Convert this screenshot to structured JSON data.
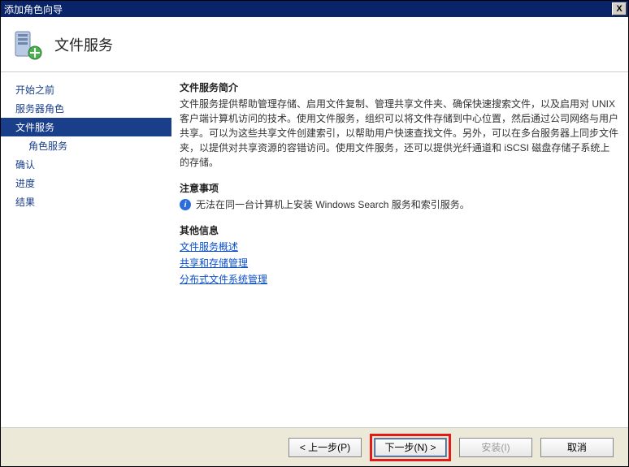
{
  "titlebar": {
    "title": "添加角色向导",
    "close": "X"
  },
  "header": {
    "title": "文件服务"
  },
  "sidebar": {
    "items": [
      {
        "label": "开始之前"
      },
      {
        "label": "服务器角色"
      },
      {
        "label": "文件服务"
      },
      {
        "label": "角色服务"
      },
      {
        "label": "确认"
      },
      {
        "label": "进度"
      },
      {
        "label": "结果"
      }
    ]
  },
  "content": {
    "intro_h": "文件服务简介",
    "intro_p": "文件服务提供帮助管理存储、启用文件复制、管理共享文件夹、确保快速搜索文件，以及启用对 UNIX 客户端计算机访问的技术。使用文件服务，组织可以将文件存储到中心位置，然后通过公司网络与用户共享。可以为这些共享文件创建索引，以帮助用户快速查找文件。另外，可以在多台服务器上同步文件夹，以提供对共享资源的容错访问。使用文件服务，还可以提供光纤通道和 iSCSI 磁盘存储子系统上的存储。",
    "notes_h": "注意事项",
    "notes_item": "无法在同一台计算机上安装 Windows Search 服务和索引服务。",
    "other_h": "其他信息",
    "links": [
      "文件服务概述",
      "共享和存储管理",
      "分布式文件系统管理"
    ]
  },
  "footer": {
    "prev": "< 上一步(P)",
    "next": "下一步(N) >",
    "install": "安装(I)",
    "cancel": "取消"
  }
}
